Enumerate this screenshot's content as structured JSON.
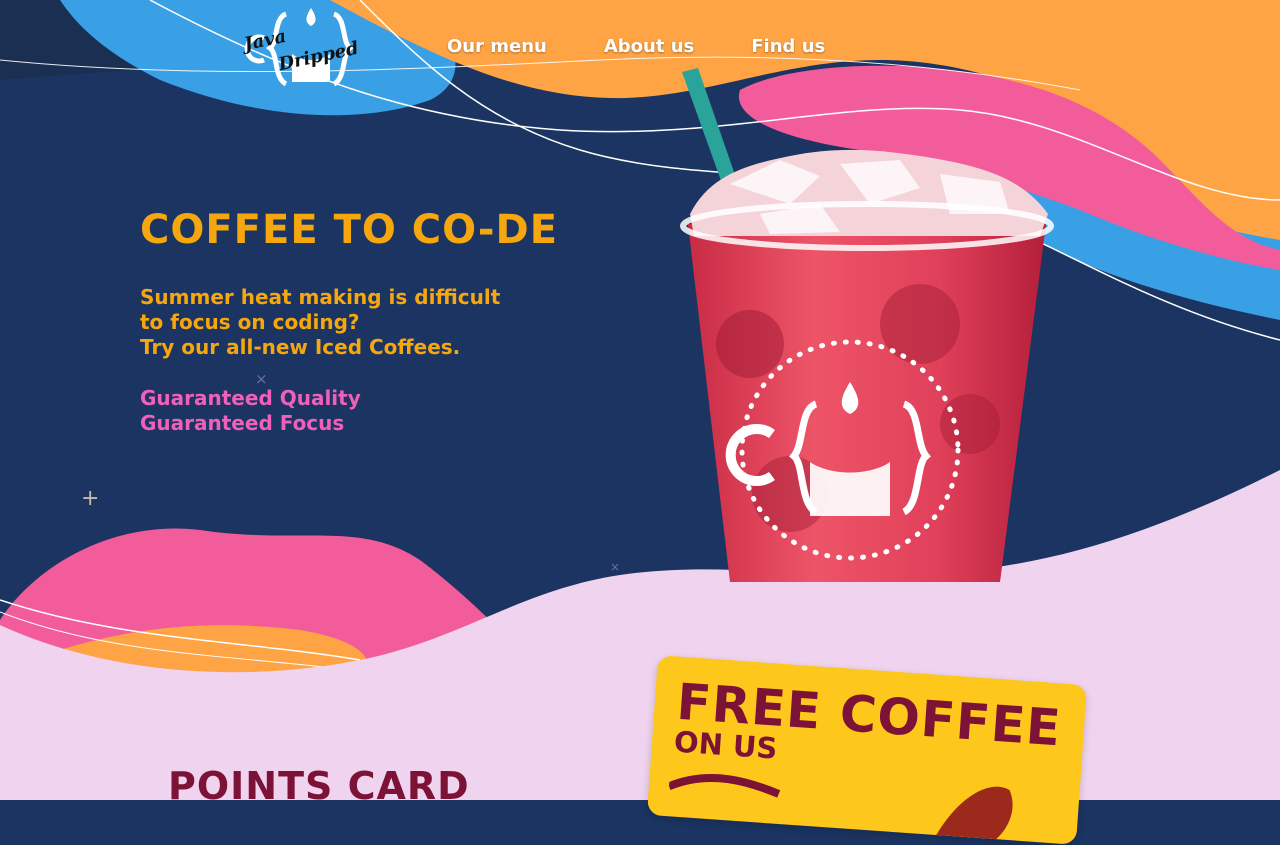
{
  "logo": {
    "line1": "Java",
    "line2": "Dripped"
  },
  "nav": {
    "items": [
      "Our menu",
      "About us",
      "Find us"
    ]
  },
  "hero": {
    "title": "COFFEE TO CO-DE",
    "lines": [
      "Summer heat making is difficult",
      "to focus on coding?",
      "Try our all-new Iced Coffees."
    ],
    "guarantees": [
      "Guaranteed Quality",
      "Guaranteed Focus"
    ]
  },
  "points": {
    "title": "POINTS CARD"
  },
  "card": {
    "headline": "FREE COFFEE",
    "subline": "ON US"
  },
  "colors": {
    "navy": "#1b3461",
    "orange": "#f7a70e",
    "pink": "#f060b8",
    "wave_pink": "#f25c9a",
    "wave_orange": "#ffa444",
    "wave_blue": "#3aa0e6",
    "lilac": "#efd3ef",
    "maroon": "#7c1236",
    "card_yellow": "#fdc81b"
  }
}
